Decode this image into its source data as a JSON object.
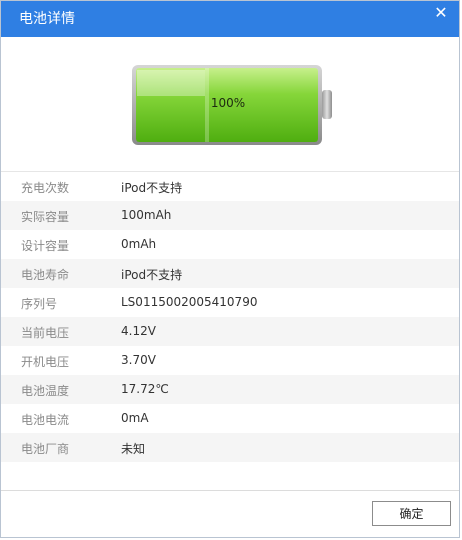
{
  "window": {
    "title": "电池详情",
    "close_symbol": "✕"
  },
  "battery": {
    "percent_label": "100%",
    "level": 1.0,
    "fill_color": "#5fc41a"
  },
  "details": [
    {
      "label": "充电次数",
      "value": "iPod不支持"
    },
    {
      "label": "实际容量",
      "value": "100mAh"
    },
    {
      "label": "设计容量",
      "value": "0mAh"
    },
    {
      "label": "电池寿命",
      "value": "iPod不支持"
    },
    {
      "label": "序列号",
      "value": "LS0115002005410790"
    },
    {
      "label": "当前电压",
      "value": "4.12V"
    },
    {
      "label": "开机电压",
      "value": "3.70V"
    },
    {
      "label": "电池温度",
      "value": "17.72℃"
    },
    {
      "label": "电池电流",
      "value": "0mA"
    },
    {
      "label": "电池厂商",
      "value": "未知"
    }
  ],
  "footer": {
    "ok_label": "确定"
  }
}
